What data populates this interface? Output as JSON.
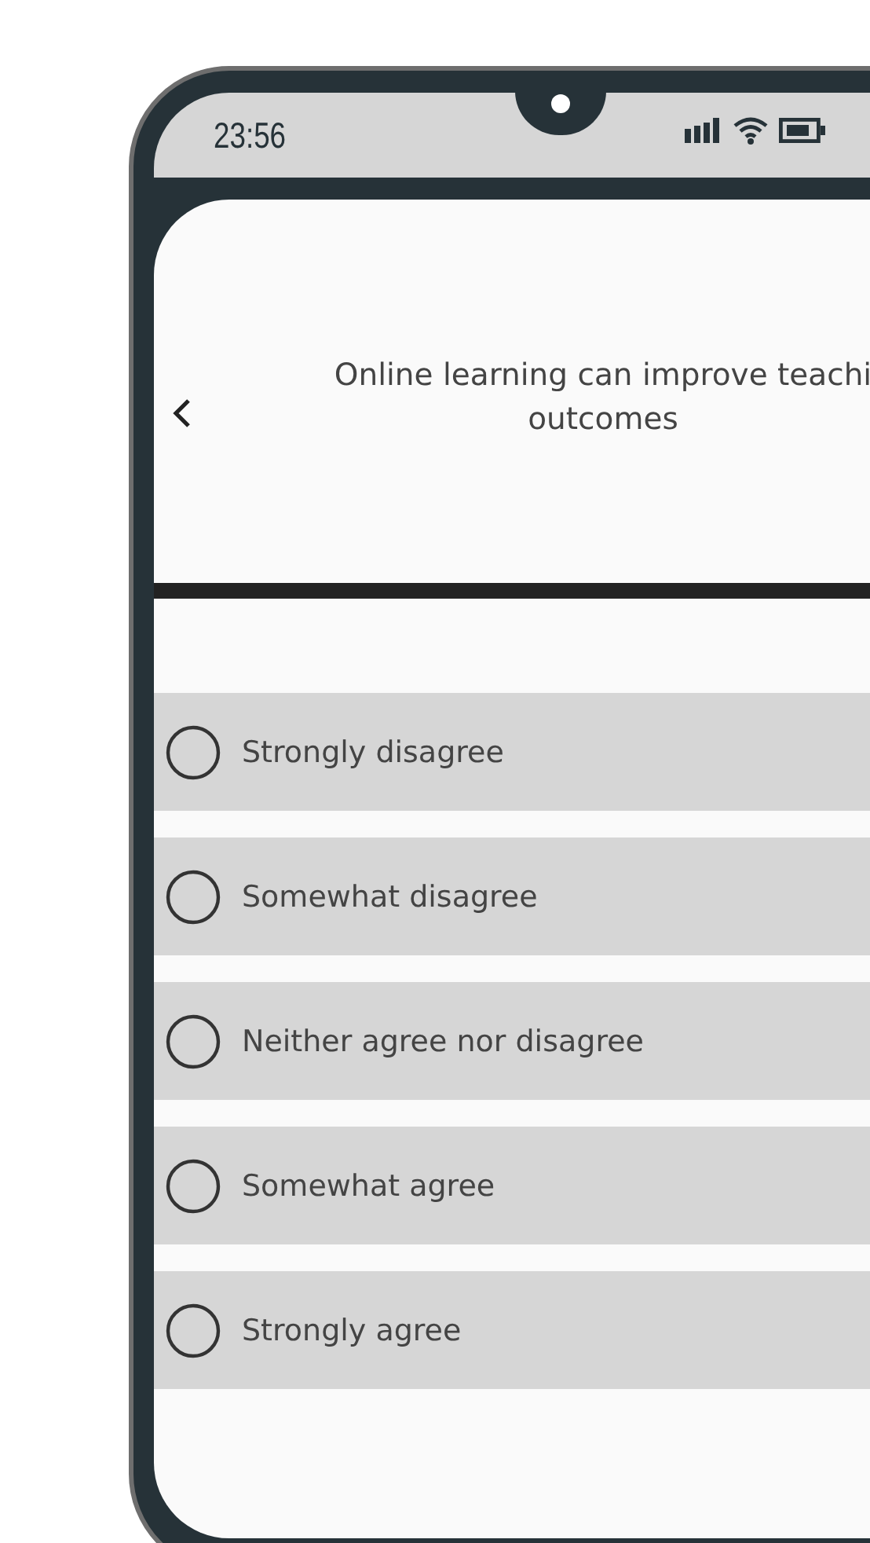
{
  "status_bar": {
    "time": "23:56"
  },
  "header": {
    "title_lines": [
      "Online learning can improve teachi",
      "outcomes"
    ]
  },
  "options": [
    {
      "label": "Strongly disagree",
      "selected": false
    },
    {
      "label": "Somewhat disagree",
      "selected": false
    },
    {
      "label": "Neither agree nor disagree",
      "selected": false
    },
    {
      "label": "Somewhat agree",
      "selected": false
    },
    {
      "label": "Strongly agree",
      "selected": false
    }
  ]
}
